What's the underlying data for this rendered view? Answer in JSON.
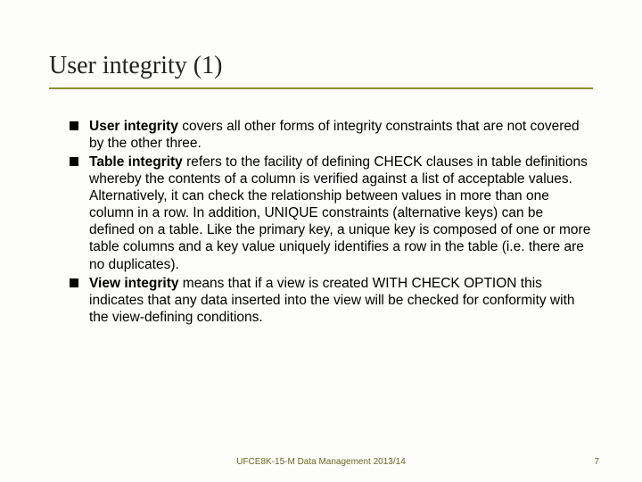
{
  "title": "User integrity (1)",
  "bullets": [
    {
      "bold": "User integrity",
      "rest": " covers all other forms of integrity constraints that are not covered by the other three."
    },
    {
      "bold": "Table integrity",
      "rest": " refers to the facility of defining CHECK clauses in table definitions whereby the contents of a column is verified against a list of acceptable values. Alternatively, it can check the relationship between values in more than one column in a row. In addition, UNIQUE constraints (alternative keys) can be defined on a table. Like the primary key, a unique key is composed of one or more table columns and a key value uniquely identifies a row in the table (i.e. there are no duplicates)."
    },
    {
      "bold": "View integrity",
      "rest": " means that if a view is created WITH CHECK OPTION this indicates that any data inserted into the view will be checked for conformity with the view-defining conditions."
    }
  ],
  "footer": {
    "center": "UFCE8K-15-M Data Management 2013/14",
    "page": "7"
  }
}
